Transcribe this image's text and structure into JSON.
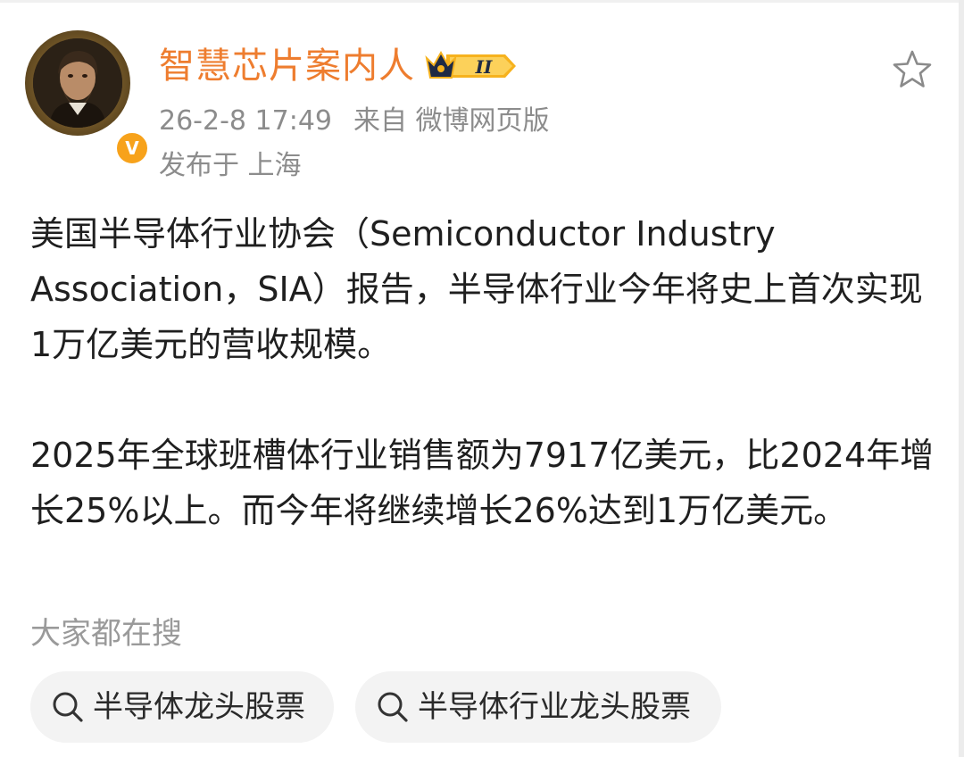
{
  "post": {
    "author": {
      "name": "智慧芯片案内人",
      "level_badge": "II",
      "verified_mark": "V"
    },
    "time": "26-2-8 17:49",
    "source": "来自 微博网页版",
    "location": "发布于 上海",
    "paragraphs": [
      "美国半导体行业协会（Semiconductor Industry Association，SIA）报告，半导体行业今年将史上首次实现1万亿美元的营收规模。",
      "2025年全球班槽体行业销售额为7917亿美元，比2024年增长25%以上。而今年将继续增长26%达到1万亿美元。"
    ]
  },
  "search": {
    "title": "大家都在搜",
    "chips": [
      {
        "label": "半导体龙头股票",
        "icon": "search-icon"
      },
      {
        "label": "半导体行业龙头股票",
        "icon": "search-icon"
      }
    ]
  },
  "icons": {
    "favorite": "star-outline-icon",
    "verified": "verified-badge-icon",
    "level": "crown-level-badge-icon"
  },
  "colors": {
    "author_name": "#ee7d2f",
    "meta_text": "#8c8c8c",
    "verified_badge": "#f7a21b",
    "level_badge": "#f6b21e",
    "chip_background": "#f3f3f3",
    "body_text": "#1f1f1f"
  }
}
